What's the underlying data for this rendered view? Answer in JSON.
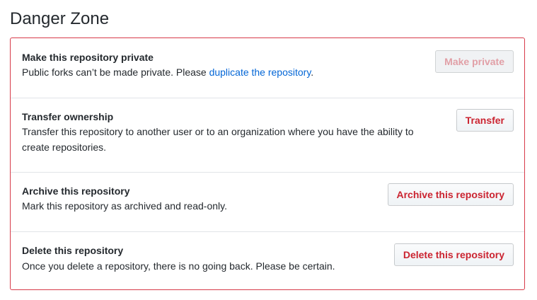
{
  "page": {
    "heading": "Danger Zone"
  },
  "colors": {
    "danger": "#d73a49",
    "danger_text": "#cb2431",
    "link": "#0366d6"
  },
  "rows": [
    {
      "title": "Make this repository private",
      "description_prefix": "Public forks can’t be made private. Please ",
      "description_link": "duplicate the repository",
      "description_suffix": ".",
      "button_label": "Make private",
      "button_disabled": true
    },
    {
      "title": "Transfer ownership",
      "description_line1": "Transfer this repository to another user or to an organization where you have the ability to",
      "description_line2": "create repositories.",
      "button_label": "Transfer",
      "button_disabled": false
    },
    {
      "title": "Archive this repository",
      "description": "Mark this repository as archived and read-only.",
      "button_label": "Archive this repository",
      "button_disabled": false
    },
    {
      "title": "Delete this repository",
      "description": "Once you delete a repository, there is no going back. Please be certain.",
      "button_label": "Delete this repository",
      "button_disabled": false
    }
  ]
}
